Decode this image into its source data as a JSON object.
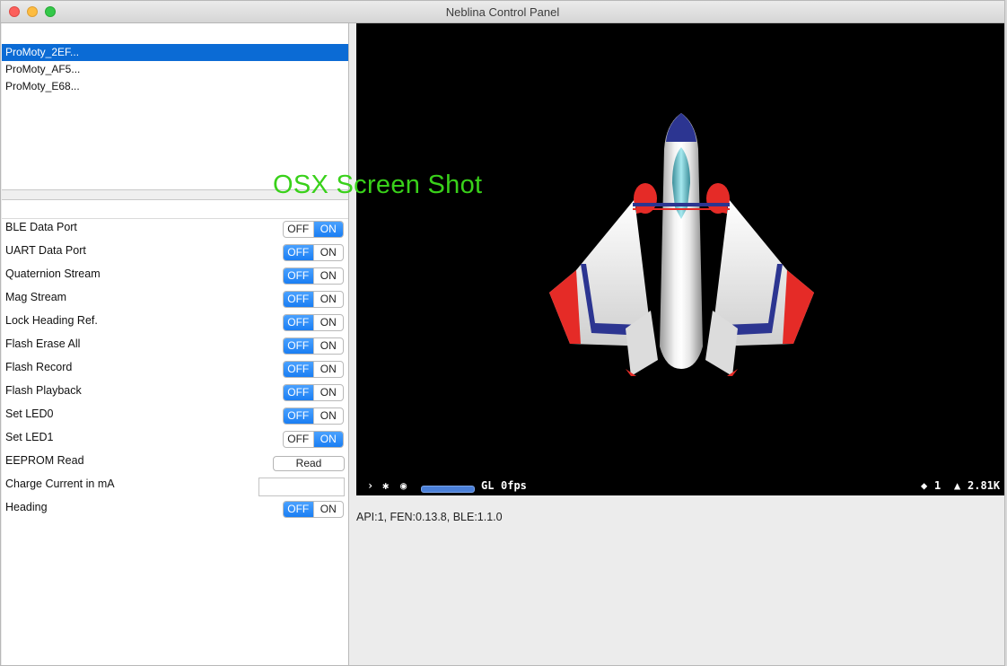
{
  "window": {
    "title": "Neblina Control Panel"
  },
  "devices": [
    {
      "name": "ProMoty_2EF...",
      "selected": true
    },
    {
      "name": "ProMoty_AF5...",
      "selected": false
    },
    {
      "name": "ProMoty_E68...",
      "selected": false
    }
  ],
  "controls": [
    {
      "label": "BLE Data Port",
      "type": "toggle",
      "off": "OFF",
      "on": "ON",
      "state": "on"
    },
    {
      "label": "UART Data Port",
      "type": "toggle",
      "off": "OFF",
      "on": "ON",
      "state": "off"
    },
    {
      "label": "Quaternion Stream",
      "type": "toggle",
      "off": "OFF",
      "on": "ON",
      "state": "off"
    },
    {
      "label": "Mag Stream",
      "type": "toggle",
      "off": "OFF",
      "on": "ON",
      "state": "off"
    },
    {
      "label": "Lock Heading Ref.",
      "type": "toggle",
      "off": "OFF",
      "on": "ON",
      "state": "off"
    },
    {
      "label": "Flash Erase All",
      "type": "toggle",
      "off": "OFF",
      "on": "ON",
      "state": "off"
    },
    {
      "label": "Flash Record",
      "type": "toggle",
      "off": "OFF",
      "on": "ON",
      "state": "off"
    },
    {
      "label": "Flash Playback",
      "type": "toggle",
      "off": "OFF",
      "on": "ON",
      "state": "off"
    },
    {
      "label": "Set LED0",
      "type": "toggle",
      "off": "OFF",
      "on": "ON",
      "state": "off"
    },
    {
      "label": "Set LED1",
      "type": "toggle",
      "off": "OFF",
      "on": "ON",
      "state": "on"
    },
    {
      "label": "EEPROM Read",
      "type": "button",
      "button": "Read"
    },
    {
      "label": "Charge Current in mA",
      "type": "input",
      "value": ""
    },
    {
      "label": "Heading",
      "type": "toggle",
      "off": "OFF",
      "on": "ON",
      "state": "off"
    }
  ],
  "scene": {
    "status": {
      "renderer": "GL",
      "fps": "0fps",
      "nodes": "1",
      "triangles": "2.81K"
    },
    "icons": [
      "chevron-right-icon",
      "gear-icon",
      "eye-icon",
      "diamond-icon",
      "triangle-icon"
    ]
  },
  "version_text": "API:1, FEN:0.13.8, BLE:1.1.0",
  "watermark": "OSX Screen Shot",
  "colors": {
    "selection": "#0b6bd5",
    "toggle_active": "#1a7ef3",
    "watermark": "#39d11a"
  }
}
